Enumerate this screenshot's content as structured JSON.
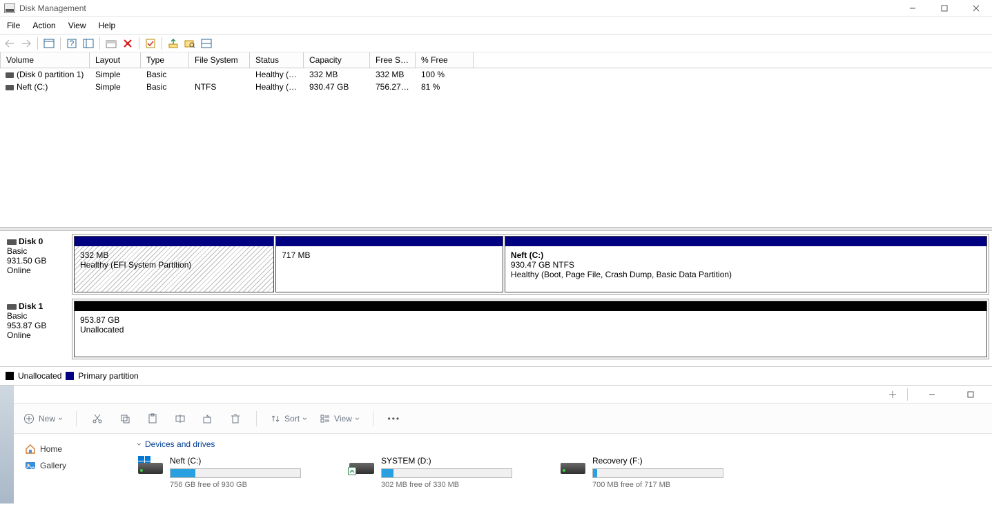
{
  "title": "Disk Management",
  "menu": [
    "File",
    "Action",
    "View",
    "Help"
  ],
  "columns": [
    "Volume",
    "Layout",
    "Type",
    "File System",
    "Status",
    "Capacity",
    "Free Spa...",
    "% Free"
  ],
  "volumes": [
    {
      "name": "(Disk 0 partition 1)",
      "layout": "Simple",
      "type": "Basic",
      "fs": "",
      "status": "Healthy (E...",
      "capacity": "332 MB",
      "free": "332 MB",
      "pct": "100 %"
    },
    {
      "name": "Neft (C:)",
      "layout": "Simple",
      "type": "Basic",
      "fs": "NTFS",
      "status": "Healthy (B...",
      "capacity": "930.47 GB",
      "free": "756.27 GB",
      "pct": "81 %"
    }
  ],
  "disks": [
    {
      "name": "Disk 0",
      "type": "Basic",
      "size": "931.50 GB",
      "state": "Online",
      "partitions": [
        {
          "stripe": "primary",
          "hatched": true,
          "widthPct": 22,
          "lines": [
            "332 MB",
            "Healthy (EFI System Partition)"
          ]
        },
        {
          "stripe": "primary",
          "hatched": false,
          "widthPct": 25,
          "lines": [
            "717 MB"
          ]
        },
        {
          "stripe": "primary",
          "hatched": false,
          "widthPct": 53,
          "boldFirst": true,
          "lines": [
            "Neft  (C:)",
            "930.47 GB NTFS",
            "Healthy (Boot, Page File, Crash Dump, Basic Data Partition)"
          ]
        }
      ]
    },
    {
      "name": "Disk 1",
      "type": "Basic",
      "size": "953.87 GB",
      "state": "Online",
      "partitions": [
        {
          "stripe": "unalloc",
          "hatched": false,
          "widthPct": 100,
          "lines": [
            "953.87 GB",
            "Unallocated"
          ]
        }
      ]
    }
  ],
  "legend": {
    "unallocated": "Unallocated",
    "primary": "Primary partition"
  },
  "explorer": {
    "new": "New",
    "sort": "Sort",
    "view": "View",
    "nav": {
      "home": "Home",
      "gallery": "Gallery"
    },
    "heading": "Devices and drives",
    "drives": [
      {
        "name": "Neft (C:)",
        "sub": "756 GB free of 930 GB",
        "fillPct": 19,
        "flag": true,
        "share": false
      },
      {
        "name": "SYSTEM (D:)",
        "sub": "302 MB free of 330 MB",
        "fillPct": 9,
        "flag": false,
        "share": true
      },
      {
        "name": "Recovery (F:)",
        "sub": "700 MB free of 717 MB",
        "fillPct": 3,
        "flag": false,
        "share": false
      }
    ]
  }
}
